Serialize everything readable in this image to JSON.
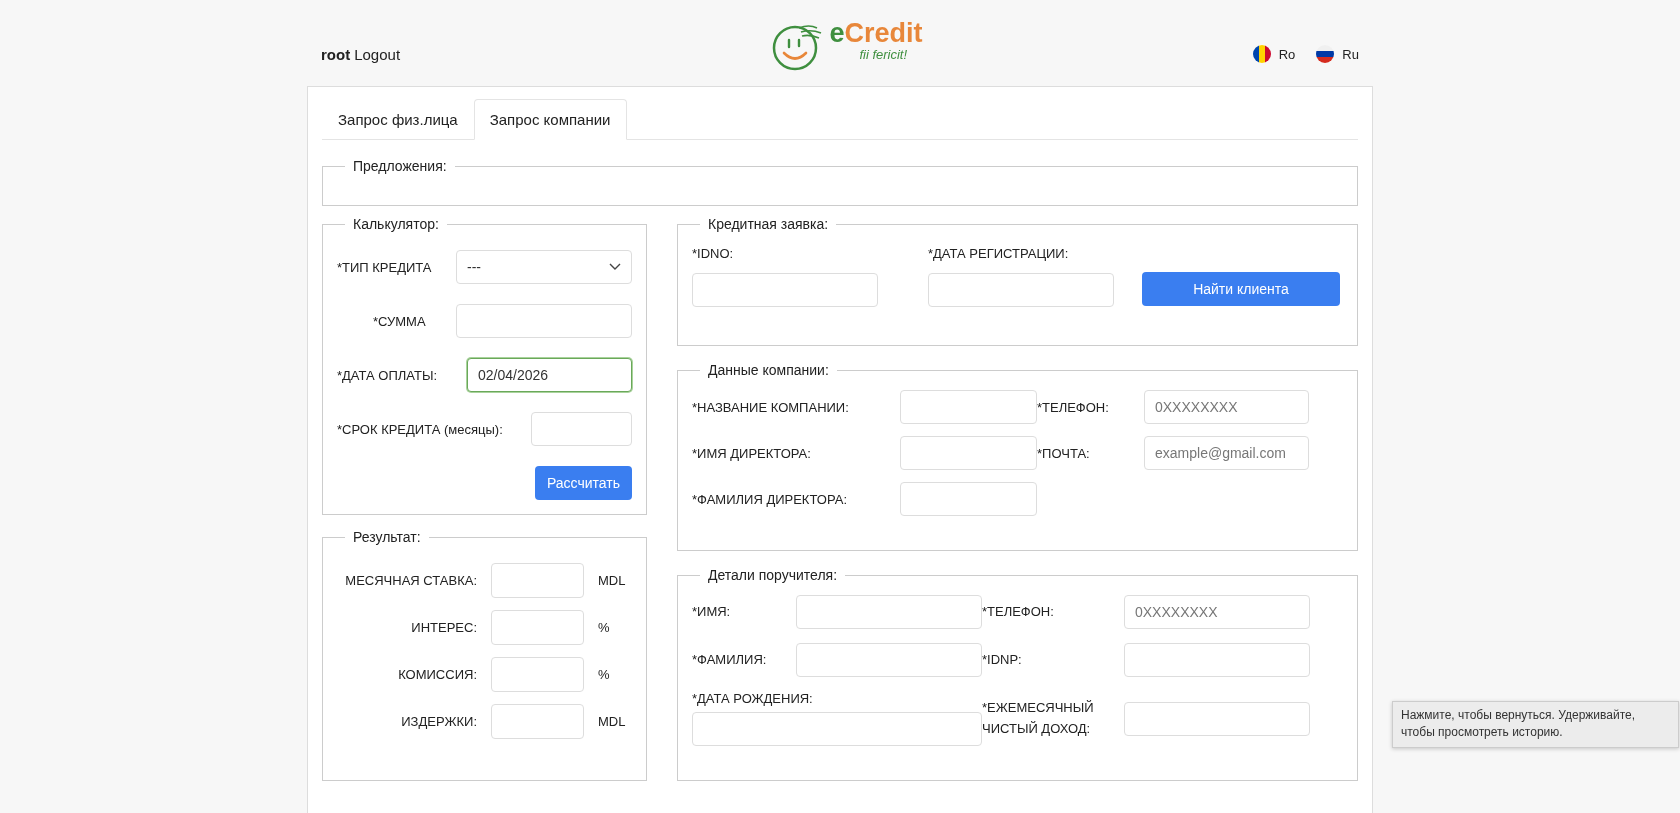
{
  "header": {
    "user": "root",
    "logout": "Logout",
    "logo": {
      "name": "eCredit",
      "tagline": "fii fericit!"
    },
    "languages": [
      {
        "kind": "moldova",
        "label": "Ro"
      },
      {
        "kind": "russia",
        "label": "Ru"
      }
    ]
  },
  "tabs": [
    {
      "label": "Запрос физ.лица",
      "selected": false
    },
    {
      "label": "Запрос компании",
      "selected": true
    }
  ],
  "offers": {
    "legend": "Предложения:"
  },
  "calculator": {
    "legend": "Калькулятор:",
    "fields": [
      {
        "label": "*ТИП КРЕДИТА",
        "kind": "select",
        "value": "---",
        "focused": false
      },
      {
        "label": "*СУММА",
        "kind": "input",
        "focused": false
      },
      {
        "label": "*ДАТА ОПЛАТЫ:",
        "kind": "input",
        "value": "02/04/2026",
        "focused": true
      },
      {
        "label": "*СРОК КРЕДИТА (месяцы):",
        "kind": "input",
        "focused": false
      }
    ],
    "button": "Рассчитать"
  },
  "result": {
    "legend": "Результат:",
    "rows": [
      {
        "label": "МЕСЯЧНАЯ СТАВКА:",
        "unit": "MDL"
      },
      {
        "label": "ИНТЕРЕС:",
        "unit": "%"
      },
      {
        "label": "КОМИССИЯ:",
        "unit": "%"
      },
      {
        "label": "ИЗДЕРЖКИ:",
        "unit": "MDL"
      }
    ]
  },
  "credit_application": {
    "legend": "Кредитная заявка:",
    "fields": [
      {
        "label": "*IDNO:"
      },
      {
        "label": "*ДАТА РЕГИСТРАЦИИ:"
      }
    ],
    "button": "Найти клиента"
  },
  "company": {
    "legend": "Данные компании:",
    "fields": [
      {
        "label": "*НАЗВАНИЕ КОМПАНИИ:"
      },
      {
        "label": "*ТЕЛЕФОН:",
        "placeholder": "0XXXXXXXX"
      },
      {
        "label": "*ИМЯ ДИРЕКТОРА:"
      },
      {
        "label": "*ПОЧТА:",
        "placeholder": "example@gmail.com"
      },
      {
        "label": "*ФАМИЛИЯ ДИРЕКТОРА:"
      }
    ]
  },
  "guarantor": {
    "legend": "Детали поручителя:",
    "fields": [
      {
        "label": "*ИМЯ:",
        "kind": "inline"
      },
      {
        "label": "*ТЕЛЕФОН:",
        "kind": "inline",
        "placeholder": "0XXXXXXXX"
      },
      {
        "label": "*ФАМИЛИЯ:",
        "kind": "inline"
      },
      {
        "label": "*IDNP:",
        "kind": "inline"
      },
      {
        "label": "*ДАТА РОЖДЕНИЯ:",
        "kind": "stacked"
      },
      {
        "label": "*ЕЖЕМЕСЯЧНЫЙ ЧИСТЫЙ ДОХОД:",
        "kind": "inline"
      }
    ]
  },
  "tooltip": {
    "text": "Нажмите, чтобы вернуться. Удерживайте, чтобы просмотреть историю."
  }
}
